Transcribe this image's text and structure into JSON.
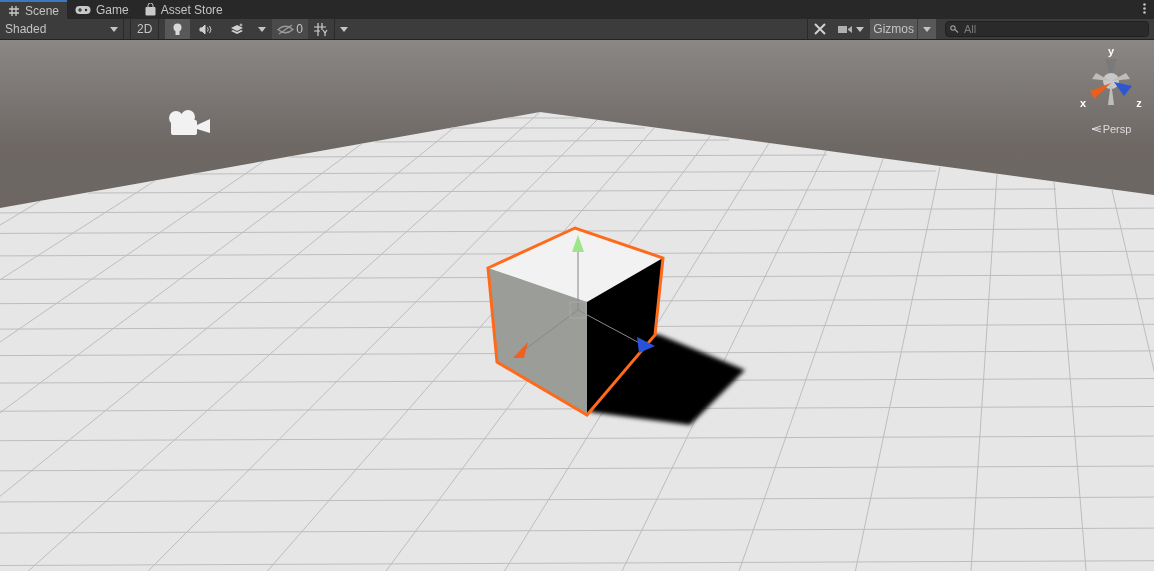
{
  "tabs": [
    {
      "label": "Scene",
      "selected": true
    },
    {
      "label": "Game",
      "selected": false
    },
    {
      "label": "Asset Store",
      "selected": false
    }
  ],
  "toolbar": {
    "shading_mode": "Shaded",
    "mode_2d": {
      "label": "2D",
      "on": false
    },
    "lighting": {
      "on": true
    },
    "audio": {
      "on": false
    },
    "effects": {
      "on": false
    },
    "hidden_count": "0",
    "gizmos": "Gizmos",
    "search": {
      "placeholder": "All"
    }
  },
  "orientation_gizmo": {
    "y_label": "y",
    "x_label": "x",
    "z_label": "z",
    "projection": "Persp"
  }
}
